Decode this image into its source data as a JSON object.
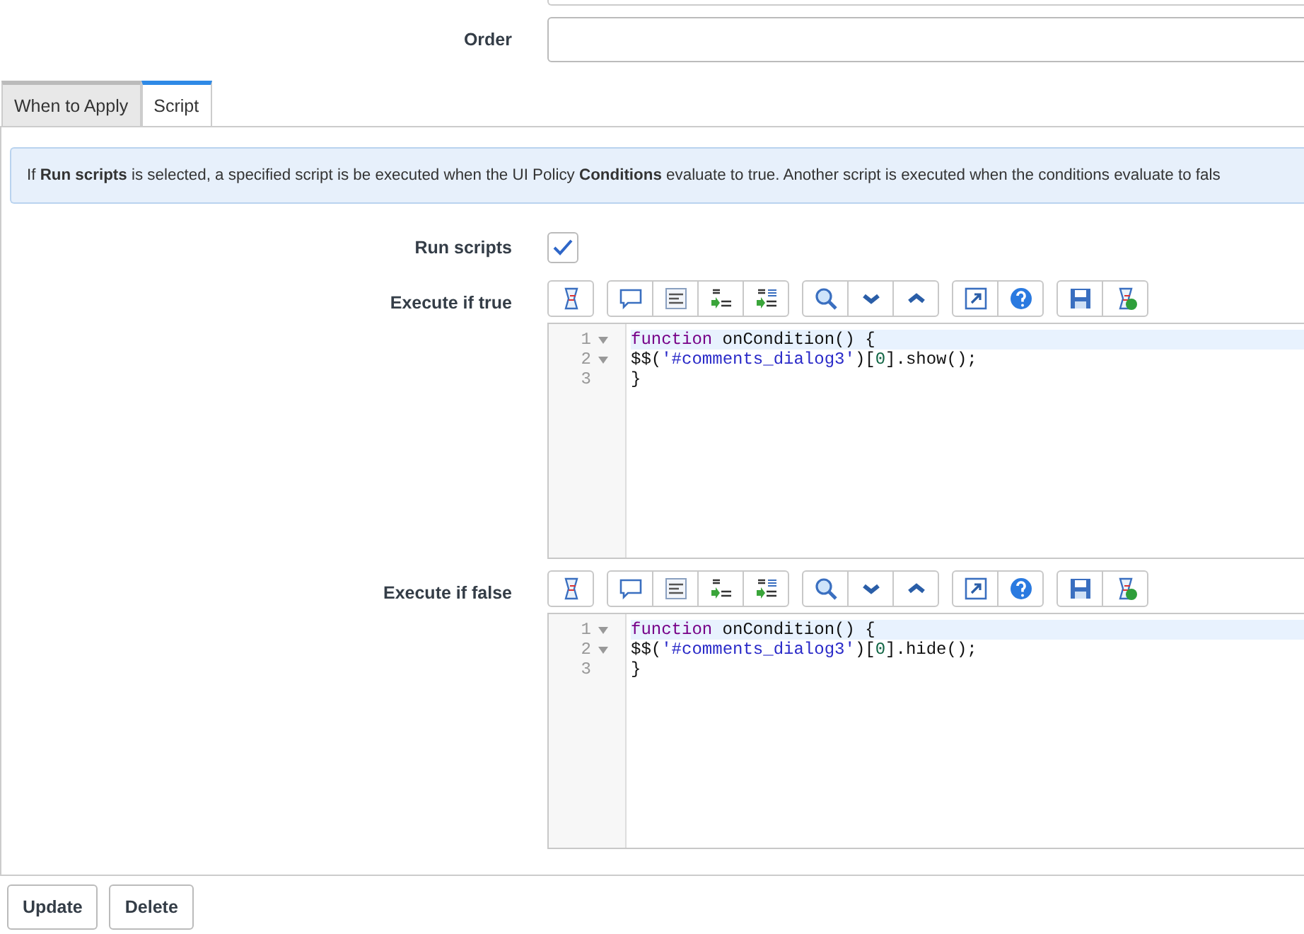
{
  "order": {
    "label": "Order"
  },
  "tabs": [
    {
      "label": "When to Apply",
      "selected": false
    },
    {
      "label": "Script",
      "selected": true
    }
  ],
  "info": "If **Run scripts** is selected, a specified script is be executed when the UI Policy **Conditions** evaluate to true. Another script is executed when the conditions evaluate to fals",
  "run_scripts": {
    "label": "Run scripts",
    "checked": true
  },
  "editors": [
    {
      "label": "Execute if true",
      "lines": [
        {
          "number": "1",
          "foldable": true,
          "active": true,
          "tokens": [
            {
              "kind": "keyword",
              "text": "function"
            },
            {
              "kind": "plain",
              "text": " onCondition() {"
            }
          ]
        },
        {
          "number": "2",
          "foldable": true,
          "active": false,
          "tokens": [
            {
              "kind": "plain",
              "text": "$$("
            },
            {
              "kind": "string",
              "text": "'#comments_dialog3'"
            },
            {
              "kind": "plain",
              "text": ")["
            },
            {
              "kind": "number",
              "text": "0"
            },
            {
              "kind": "plain",
              "text": "].show();"
            }
          ]
        },
        {
          "number": "3",
          "foldable": false,
          "active": false,
          "tokens": [
            {
              "kind": "plain",
              "text": "}"
            }
          ]
        }
      ]
    },
    {
      "label": "Execute if false",
      "lines": [
        {
          "number": "1",
          "foldable": true,
          "active": true,
          "tokens": [
            {
              "kind": "keyword",
              "text": "function"
            },
            {
              "kind": "plain",
              "text": " onCondition() {"
            }
          ]
        },
        {
          "number": "2",
          "foldable": true,
          "active": false,
          "tokens": [
            {
              "kind": "plain",
              "text": "$$("
            },
            {
              "kind": "string",
              "text": "'#comments_dialog3'"
            },
            {
              "kind": "plain",
              "text": ")["
            },
            {
              "kind": "number",
              "text": "0"
            },
            {
              "kind": "plain",
              "text": "].hide();"
            }
          ]
        },
        {
          "number": "3",
          "foldable": false,
          "active": false,
          "tokens": [
            {
              "kind": "plain",
              "text": "}"
            }
          ]
        }
      ]
    }
  ],
  "buttons": [
    "Update",
    "Delete"
  ]
}
